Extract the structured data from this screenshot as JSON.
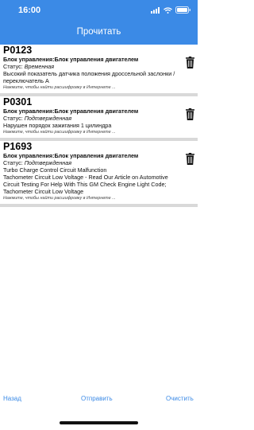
{
  "status_bar": {
    "time": "16:00"
  },
  "nav": {
    "title": "Прочитать"
  },
  "codes": [
    {
      "code": "P0123",
      "module": "Блок управления:Блок управления двигателем",
      "status_label": "Статус:",
      "status_value": "Временная",
      "description": "Высокий показатель датчика положения дроссельной заслонки / переключатель A",
      "hint": "Нажмите, чтобы найти расшифровку в Интернете ..."
    },
    {
      "code": "P0301",
      "module": "Блок управления:Блок управления двигателем",
      "status_label": "Статус:",
      "status_value": "Подтвержденная",
      "description": "Нарушен порядок зажигания 1 цилиндра",
      "hint": "Нажмите, чтобы найти расшифровку в Интернете ..."
    },
    {
      "code": "P1693",
      "module": "Блок управления:Блок управления двигателем",
      "status_label": "Статус:",
      "status_value": "Подтвержденная",
      "description": "Turbo Charge Control Circuit Malfunction\nTachometer Circuit Low Voltage - Read Our Article on Automotive Circuit Testing For Help With This GM Check Engine Light Code; Tachometer Circuit Low Voltage",
      "hint": "Нажмите, чтобы найти расшифровку в Интернете ..."
    }
  ],
  "toolbar": {
    "back_label": "Назад",
    "send_label": "Отправить",
    "clear_label": "Очистить"
  },
  "colors": {
    "accent": "#3b8ae6",
    "separator": "#d9d9d9"
  }
}
